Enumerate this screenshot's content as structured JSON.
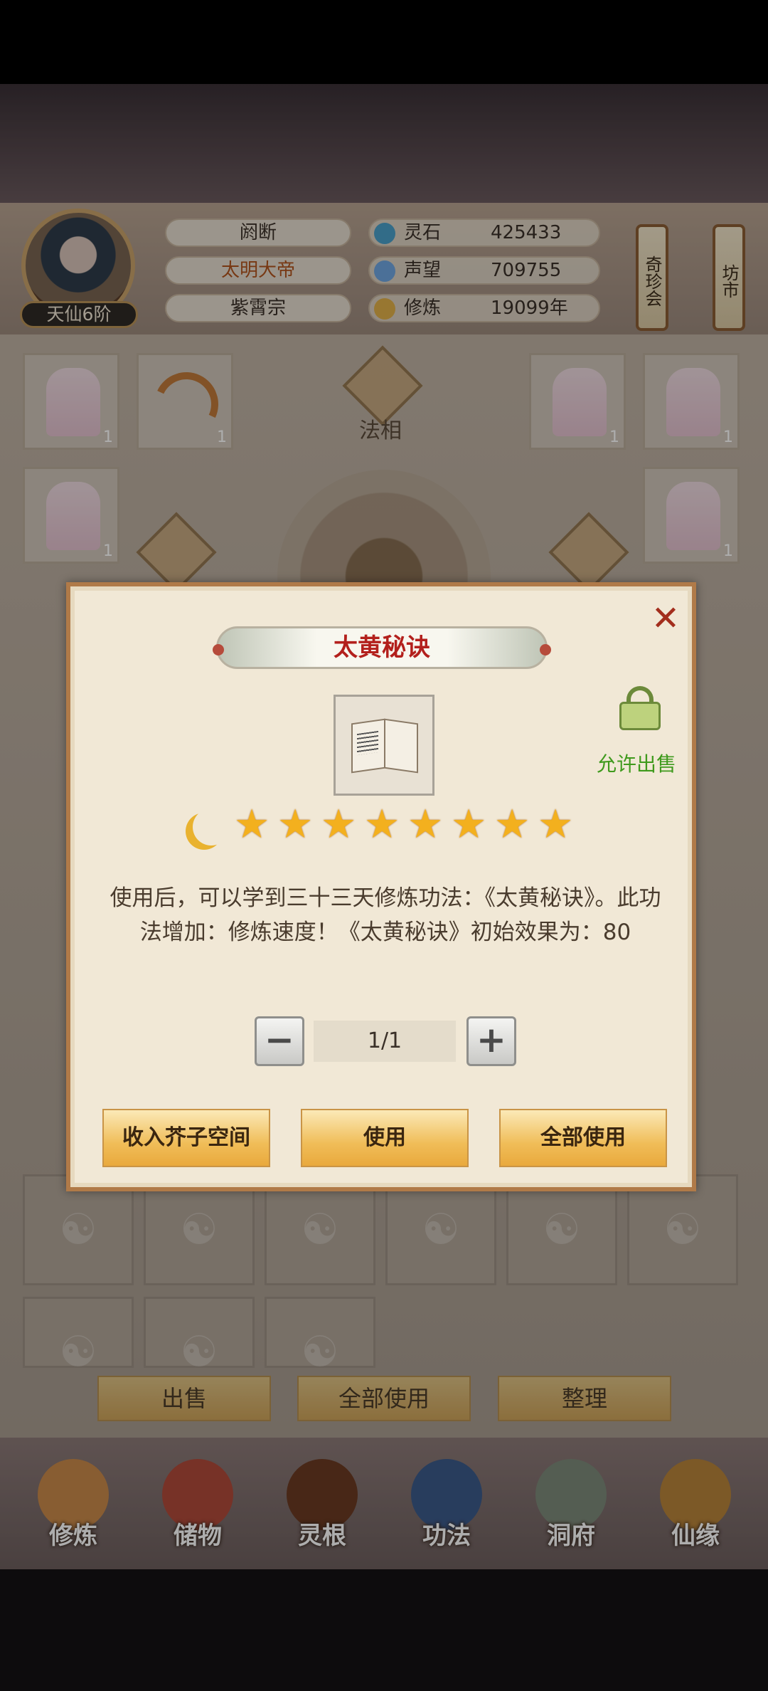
{
  "player": {
    "name": "阏断",
    "title": "太明大帝",
    "sect": "紫霄宗",
    "rank": "天仙6阶"
  },
  "stats": [
    {
      "label": "灵石",
      "value": "425433",
      "icon": "spirit-stone-icon"
    },
    {
      "label": "声望",
      "value": "709755",
      "icon": "reputation-icon"
    },
    {
      "label": "修炼",
      "value": "19099年",
      "icon": "meditation-icon"
    }
  ],
  "side_scrolls": [
    "奇珍会",
    "坊市"
  ],
  "equipment": {
    "center_label": "法相",
    "slot_counts": [
      "1",
      "1",
      "1",
      "1",
      "1",
      "1"
    ]
  },
  "inventory_bar": {
    "sell": "出售",
    "use_all": "全部使用",
    "sort": "整理"
  },
  "nav": [
    "修炼",
    "储物",
    "灵根",
    "功法",
    "洞府",
    "仙缘"
  ],
  "dialog": {
    "title": "太黄秘诀",
    "sell_status": "允许出售",
    "stars": 8,
    "description": "使用后，可以学到三十三天修炼功法：《太黄秘诀》。此功法增加：修炼速度！《太黄秘诀》初始效果为：80",
    "quantity": "1/1",
    "buttons": {
      "store": "收入芥子空间",
      "use": "使用",
      "use_all": "全部使用"
    }
  },
  "colors": {
    "title_red": "#b3201c",
    "sell_green": "#3f9a1d",
    "star_gold": "#f3b01e",
    "button_gold": "#f0bd58"
  }
}
